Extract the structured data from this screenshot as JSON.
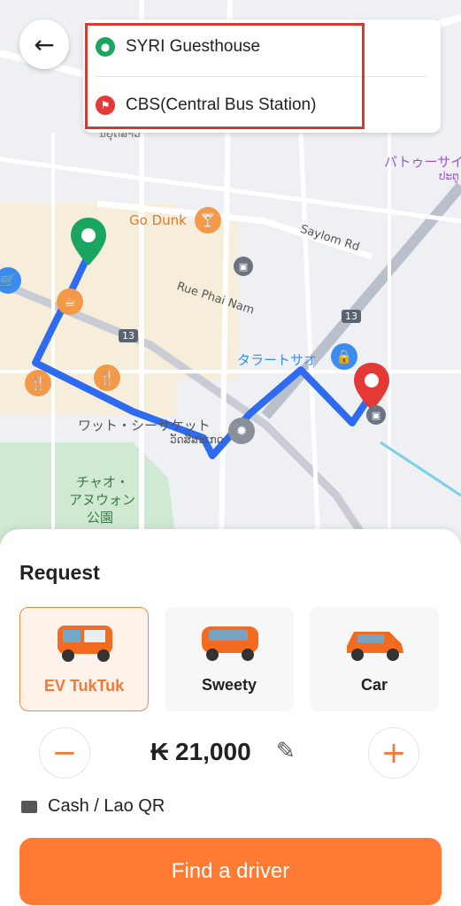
{
  "route": {
    "origin": "SYRI Guesthouse",
    "destination": "CBS(Central Bus Station)"
  },
  "map": {
    "labels": {
      "go_dunk": "Go Dunk",
      "saylom_rd": "Saylom Rd",
      "rue_phai_nam": "Rue Phai Nam",
      "talat_sao": "タラートサオ",
      "wat_sisaket_jp": "ワット・シーサケット",
      "wat_sisaket_lao": "ວັດສີສະເກດ",
      "chao_anouvong_1": "チャオ・",
      "chao_anouvong_2": "アヌウォン",
      "chao_anouvong_3": "公園",
      "patuxai": "パトゥーサイ",
      "patuxai_lao": "ປະຕູ",
      "road_13a": "13",
      "road_13b": "13",
      "partial_top": "ນຍຸດສາວ"
    }
  },
  "sheet": {
    "title": "Request",
    "vehicles": [
      {
        "label": "EV TukTuk"
      },
      {
        "label": "Sweety"
      },
      {
        "label": "Car"
      }
    ],
    "minus": "−",
    "plus": "+",
    "price": "₭ 21,000",
    "payment": "Cash / Lao QR",
    "find_button": "Find a driver"
  },
  "colors": {
    "accent": "#FF7A32",
    "route_line": "#2E6BF0",
    "origin_pin": "#1AA561",
    "destination_pin": "#E53935",
    "highlight_box": "#D23C33"
  },
  "icons": {
    "back": "arrow-left-icon",
    "origin": "person-pin-icon",
    "destination": "flag-pin-icon",
    "edit": "pencil-icon",
    "wallet": "wallet-icon"
  }
}
